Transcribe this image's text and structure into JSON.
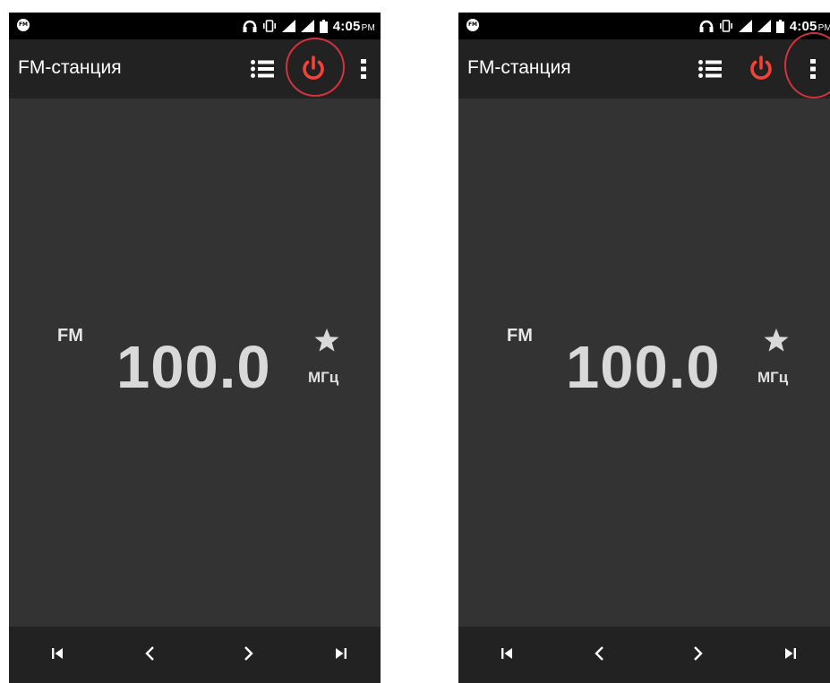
{
  "screens": [
    {
      "status_bar": {
        "app_icon": "fm-radio-notification-icon",
        "icons": [
          "headphones-icon",
          "vibrate-icon",
          "signal-icon",
          "signal-icon",
          "battery-icon"
        ],
        "time": "4:05",
        "ampm": "PM"
      },
      "app_bar": {
        "title": "FM-станция",
        "actions": [
          "list-icon",
          "power-icon",
          "more-vert-icon"
        ],
        "highlighted_action": "power-icon",
        "accent_color": "#f44336"
      },
      "tuner": {
        "band": "FM",
        "frequency": "100.0",
        "unit": "МГц",
        "favorite_icon": "star-icon"
      },
      "bottom_bar": {
        "buttons": [
          "skip-previous-icon",
          "chevron-left-icon",
          "chevron-right-icon",
          "skip-next-icon"
        ]
      }
    },
    {
      "status_bar": {
        "app_icon": "fm-radio-notification-icon",
        "icons": [
          "headphones-icon",
          "vibrate-icon",
          "signal-icon",
          "signal-icon",
          "battery-icon"
        ],
        "time": "4:05",
        "ampm": "PM"
      },
      "app_bar": {
        "title": "FM-станция",
        "actions": [
          "list-icon",
          "power-icon",
          "more-vert-icon"
        ],
        "highlighted_action": "more-vert-icon",
        "accent_color": "#f44336"
      },
      "tuner": {
        "band": "FM",
        "frequency": "100.0",
        "unit": "МГц",
        "favorite_icon": "star-icon"
      },
      "bottom_bar": {
        "buttons": [
          "skip-previous-icon",
          "chevron-left-icon",
          "chevron-right-icon",
          "skip-next-icon"
        ]
      }
    }
  ],
  "highlight_color": "#d4323c"
}
